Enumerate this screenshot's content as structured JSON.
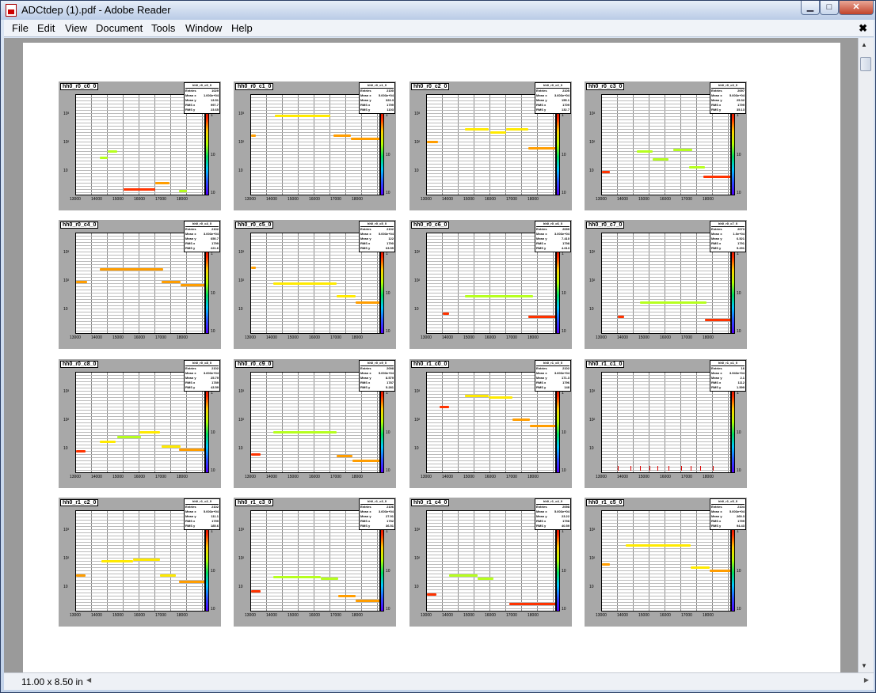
{
  "window": {
    "title": "ADCtdep (1).pdf - Adobe Reader"
  },
  "menu": [
    "File",
    "Edit",
    "View",
    "Document",
    "Tools",
    "Window",
    "Help"
  ],
  "status": {
    "page_size": "11.00 x 8.50 in"
  },
  "plot_axes": {
    "x_ticks": [
      "13000",
      "14000",
      "15000",
      "16000",
      "17000",
      "18000"
    ],
    "y_ticks": [
      "10³",
      "10²",
      "10"
    ],
    "cbar_ticks": [
      "1",
      "10",
      "10"
    ]
  },
  "panels": [
    {
      "name": "hh0_r0_c0_0",
      "stat_name": "hh0_r0_c0_0",
      "entries": "1029",
      "meanx": "1.003e+04",
      "meany": "13.51",
      "rmsx": "997.7",
      "rmsy": "23.65"
    },
    {
      "name": "hh0_r0_c1_0",
      "stat_name": "hh0_r0_c1_0",
      "entries": "2100",
      "meanx": "5.003e+04",
      "meany": "323.3",
      "rmsx": "1799",
      "rmsy": "1103"
    },
    {
      "name": "hh0_r0_c2_0",
      "stat_name": "hh0_r0_c2_0",
      "entries": "2105",
      "meanx": "3.603e+04",
      "meany": "155.1",
      "rmsx": "1709",
      "rmsy": "132.7"
    },
    {
      "name": "hh0_r0_c3_0",
      "stat_name": "hh0_r0_c3_0",
      "entries": "2097",
      "meanx": "5.003e+04",
      "meany": "25.32",
      "rmsx": "1799",
      "rmsy": "35.13"
    },
    {
      "name": "hh0_r0_c4_0",
      "stat_name": "hh0_r0_c4_0",
      "entries": "2102",
      "meanx": "3.003e+04",
      "meany": "650.7",
      "rmsx": "1799",
      "rmsy": "221.6"
    },
    {
      "name": "hh0_r0_c5_0",
      "stat_name": "hh0_r0_c5_0",
      "entries": "2102",
      "meanx": "5.003e+04",
      "meany": "122",
      "rmsx": "1790",
      "rmsy": "63.55"
    },
    {
      "name": "hh0_r0_c6_0",
      "stat_name": "hh0_r0_c6_0",
      "entries": "2099",
      "meanx": "3.003e+04",
      "meany": "7.410",
      "rmsx": "1798",
      "rmsy": "4.613"
    },
    {
      "name": "hh0_r0_c7_0",
      "stat_name": "hh0_r0_c7_0",
      "entries": "2073",
      "meanx": "1.0e+04",
      "meany": "6.521",
      "rmsx": "1791",
      "rmsy": "5.291"
    },
    {
      "name": "hh0_r0_c8_0",
      "stat_name": "hh0_r0_c8_0",
      "entries": "2102",
      "meanx": "3.603e+04",
      "meany": "25.79",
      "rmsx": "1789",
      "rmsy": "43.59"
    },
    {
      "name": "hh0_r0_c9_0",
      "stat_name": "hh0_r0_c9_0",
      "entries": "2098",
      "meanx": "5.003e+04",
      "meany": "8.579",
      "rmsx": "1787",
      "rmsy": "5.281"
    },
    {
      "name": "hh0_r1_c0_0",
      "stat_name": "hh0_r1_c0_0",
      "entries": "2102",
      "meanx": "3.603e+04",
      "meany": "171.3",
      "rmsx": "1796",
      "rmsy": "148"
    },
    {
      "name": "hh0_r1_c1_0",
      "stat_name": "hh0_r1_c1_0",
      "entries": "16",
      "meanx": "3.943e+04",
      "meany": "2.1",
      "rmsx": "1112",
      "rmsy": "1.599"
    },
    {
      "name": "hh0_r1_c2_0",
      "stat_name": "hh0_r1_c2_0",
      "entries": "2102",
      "meanx": "5.003e+04",
      "meany": "111.1",
      "rmsx": "1799",
      "rmsy": "185.6"
    },
    {
      "name": "hh0_r1_c3_0",
      "stat_name": "hh0_r1_c3_0",
      "entries": "2106",
      "meanx": "3.603e+04",
      "meany": "27.91",
      "rmsx": "1792",
      "rmsy": "36.51"
    },
    {
      "name": "hh0_r1_c4_0",
      "stat_name": "hh0_r1_c4_0",
      "entries": "2098",
      "meanx": "5.003e+04",
      "meany": "23.22",
      "rmsx": "1798",
      "rmsy": "40.59"
    },
    {
      "name": "hh0_r1_c5_0",
      "stat_name": "hh0_r1_c5_0",
      "entries": "2104",
      "meanx": "5.003e+04",
      "meany": "269.3",
      "rmsx": "1799",
      "rmsy": "94.43"
    }
  ]
}
